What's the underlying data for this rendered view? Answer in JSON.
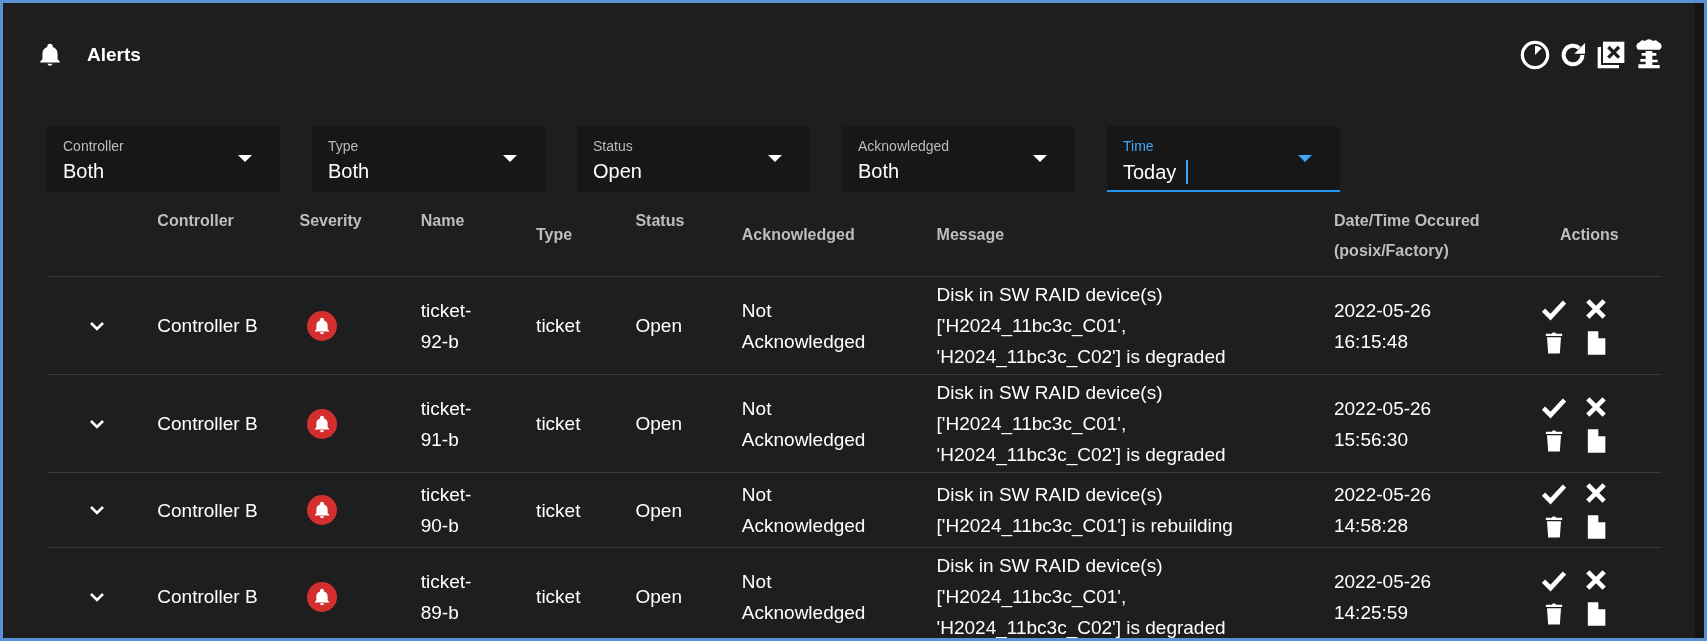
{
  "header": {
    "title": "Alerts"
  },
  "toolbar": [
    {
      "kind": "timer"
    },
    {
      "kind": "refresh"
    },
    {
      "kind": "clear"
    },
    {
      "kind": "mushroom"
    }
  ],
  "filters": [
    {
      "label": "Controller",
      "value": "Both",
      "focused": false
    },
    {
      "label": "Type",
      "value": "Both",
      "focused": false
    },
    {
      "label": "Status",
      "value": "Open",
      "focused": false
    },
    {
      "label": "Acknowledged",
      "value": "Both",
      "focused": false
    },
    {
      "label": "Time",
      "value": "Today",
      "focused": true
    }
  ],
  "table": {
    "columns": [
      "Controller",
      "Severity",
      "Name",
      "Type",
      "Status",
      "Acknowledged",
      "Message",
      "Date/Time Occured (posix/Factory)",
      "Actions"
    ],
    "rows": [
      {
        "controller": "Controller B",
        "color": "#d32f2f",
        "name": "ticket-92-b",
        "type": "ticket",
        "status": "Open",
        "acknowledged": "Not Acknowledged",
        "message": "Disk in SW RAID device(s) ['H2024_11bc3c_C01', 'H2024_11bc3c_C02'] is degraded",
        "datetime": "2022-05-26 16:15:48"
      },
      {
        "controller": "Controller B",
        "color": "#d32f2f",
        "name": "ticket-91-b",
        "type": "ticket",
        "status": "Open",
        "acknowledged": "Not Acknowledged",
        "message": "Disk in SW RAID device(s) ['H2024_11bc3c_C01', 'H2024_11bc3c_C02'] is degraded",
        "datetime": "2022-05-26 15:56:30"
      },
      {
        "controller": "Controller B",
        "color": "#d32f2f",
        "name": "ticket-90-b",
        "type": "ticket",
        "status": "Open",
        "acknowledged": "Not Acknowledged",
        "message": "Disk in SW RAID device(s) ['H2024_11bc3c_C01'] is rebuilding",
        "datetime": "2022-05-26 14:58:28"
      },
      {
        "controller": "Controller B",
        "color": "#d32f2f",
        "name": "ticket-89-b",
        "type": "ticket",
        "status": "Open",
        "acknowledged": "Not Acknowledged",
        "message": "Disk in SW RAID device(s) ['H2024_11bc3c_C01', 'H2024_11bc3c_C02'] is degraded",
        "datetime": "2022-05-26 14:25:59"
      }
    ]
  }
}
